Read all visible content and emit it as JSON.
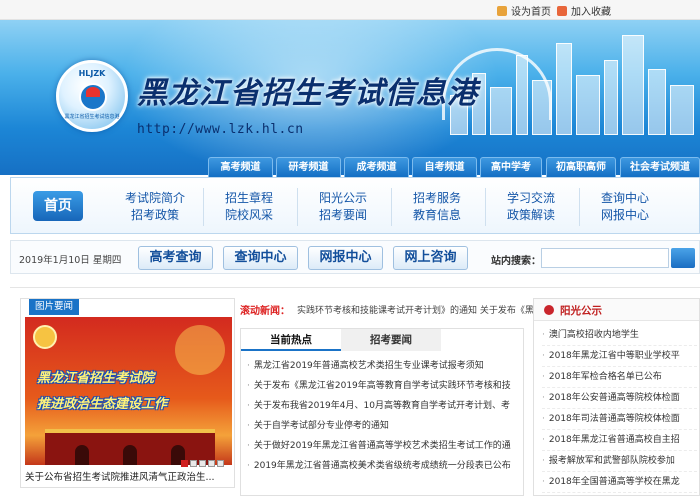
{
  "top_links": {
    "set_home": "设为首页",
    "bookmark": "加入收藏"
  },
  "header": {
    "logo_text": "HLJZK",
    "logo_sub": "黑龙江省招生考试信息港",
    "site_title": "黑龙江省招生考试信息港",
    "site_url": "http://www.lzk.hl.cn"
  },
  "channels": [
    "高考频道",
    "研考频道",
    "成考频道",
    "自考频道",
    "高中学考",
    "初高职高师",
    "社会考试频道"
  ],
  "nav": {
    "home": "首页",
    "columns": [
      [
        "考试院简介",
        "招考政策"
      ],
      [
        "招生章程",
        "院校风采"
      ],
      [
        "阳光公示",
        "招考要闻"
      ],
      [
        "招考服务",
        "教育信息"
      ],
      [
        "学习交流",
        "政策解读"
      ],
      [
        "查询中心",
        "网报中心"
      ]
    ]
  },
  "toolbar": {
    "date": "2019年1月10日 星期四",
    "buttons": [
      "高考查询",
      "查询中心",
      "网报中心",
      "网上咨询"
    ],
    "search_label": "站内搜索：",
    "search_value": ""
  },
  "photo_news": {
    "tab": "图片要闻",
    "headline_1": "黑龙江省招生考试院",
    "headline_2": "推进政治生态建设工作",
    "caption": "关于公布省招生考试院推进风清气正政治生...",
    "dots": [
      1,
      2,
      3,
      4,
      5
    ]
  },
  "scroll": {
    "label": "滚动新闻：",
    "text": "实践环节考核和技能课考试开考计划》的通知     关于发布《黑"
  },
  "news": {
    "tab_active": "当前热点",
    "tab_inactive": "招考要闻",
    "bullet": "·",
    "items": [
      "黑龙江省2019年普通高校艺术类招生专业课考试报考须知",
      "关于发布《黑龙江省2019年高等教育自学考试实践环节考核和技",
      "关于发布我省2019年4月、10月高等教育自学考试开考计划、考",
      "关于自学考试部分专业停考的通知",
      "关于做好2019年黑龙江省普通高等学校艺术类招生考试工作的通",
      "2019年黑龙江省普通高校美术类省级统考成绩统一分段表已公布"
    ]
  },
  "sunshine": {
    "title": "阳光公示",
    "bullet": "·",
    "items": [
      "澳门高校招收内地学生",
      "2018年黑龙江省中等职业学校平",
      "2018年军检合格名单已公布",
      "2018年公安普通高等院校体检面",
      "2018年司法普通高等院校体检面",
      "2018年黑龙江省普通高校自主招",
      "报考解放军和武警部队院校参加",
      "2018年全国普通高等学校在黑龙"
    ]
  }
}
